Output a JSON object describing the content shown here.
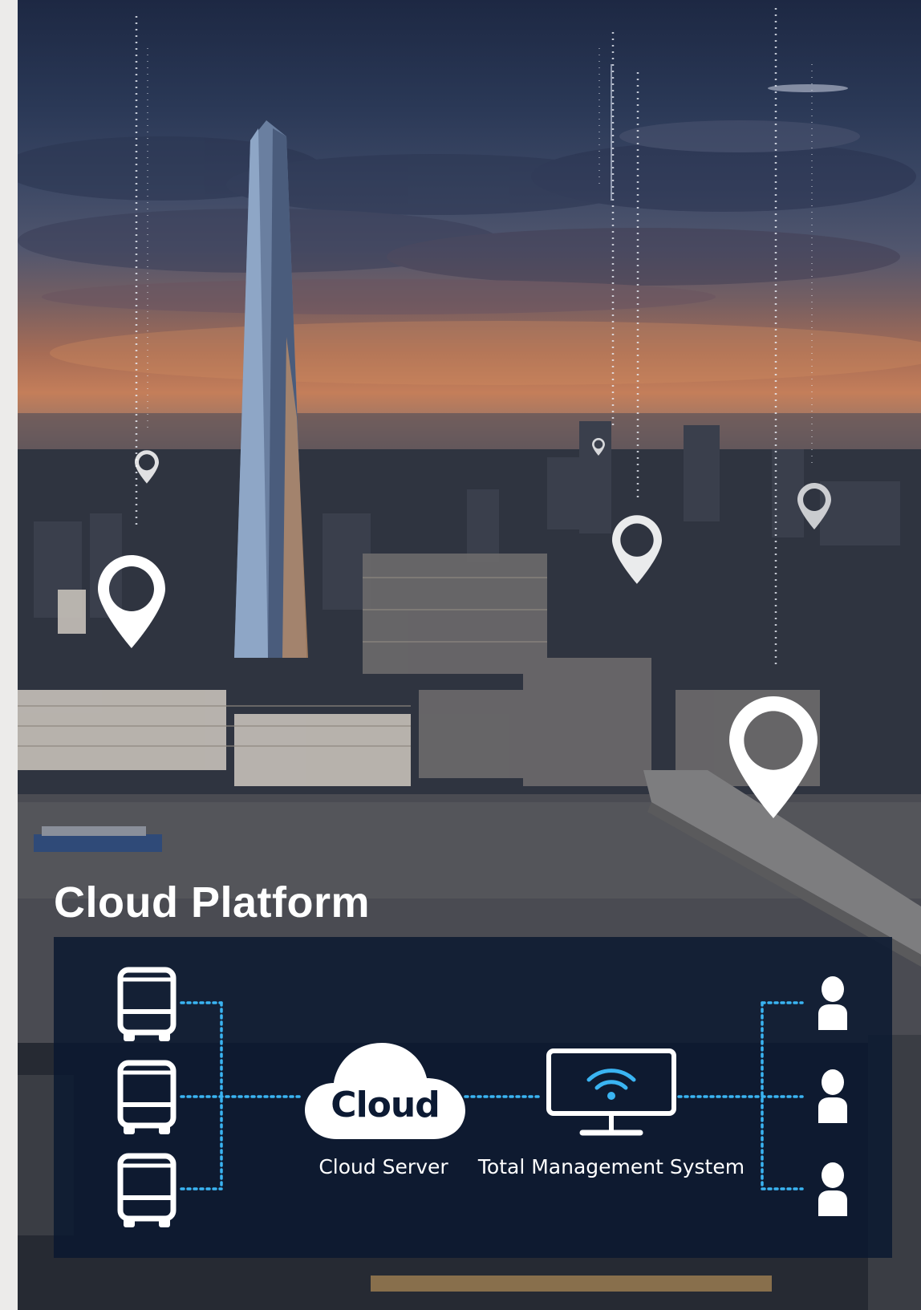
{
  "diagram": {
    "title": "Cloud Platform",
    "nodes": {
      "cloud_word": "Cloud",
      "cloud_server_label": "Cloud Server",
      "management_label": "Total Management System"
    },
    "icons": {
      "bus": "bus-icon",
      "cloud": "cloud-icon",
      "monitor": "monitor-wifi-icon",
      "user": "user-icon",
      "pin": "location-pin-icon"
    },
    "colors": {
      "connector": "#3ab4f2",
      "panel": "#0a1830",
      "text": "#ffffff"
    }
  }
}
